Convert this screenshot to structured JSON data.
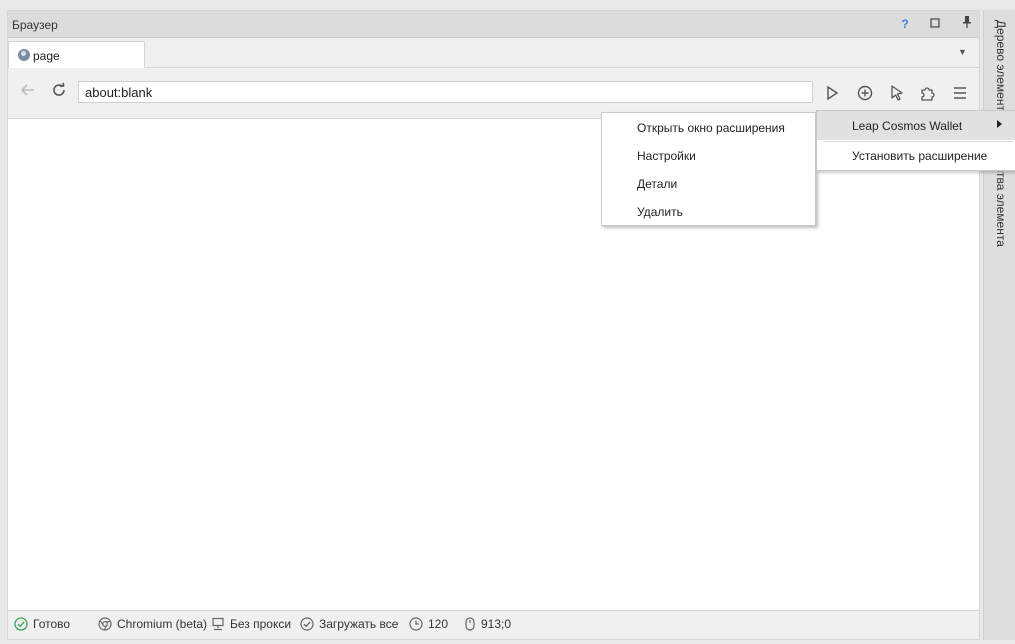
{
  "window": {
    "title": "Браузер",
    "help_label": "?"
  },
  "tabs": [
    {
      "label": "page",
      "icon": "globe-icon"
    }
  ],
  "toolbar": {
    "address_value": "about:blank",
    "icons": [
      "back-arrow-icon",
      "reload-icon",
      "play-icon",
      "add-circle-icon",
      "cursor-icon",
      "puzzle-icon",
      "menu-icon"
    ]
  },
  "context_menu": {
    "items": [
      "Открыть окно расширения",
      "Настройки",
      "Детали",
      "Удалить"
    ]
  },
  "submenu": {
    "items": [
      "Leap Cosmos Wallet",
      "Установить расширение"
    ]
  },
  "side_panel": {
    "top_label": "Дерево элементо",
    "bottom_label": "ства элемента"
  },
  "status": {
    "state": "Готово",
    "engine": "Chromium (beta)",
    "proxy": "Без прокси",
    "load": "Загружать все",
    "timeout": "120",
    "coords": "913;0"
  },
  "colors": {
    "help_blue": "#3e7de4",
    "ok_green": "#3aa655",
    "viewport_bg": "#ffffff"
  }
}
